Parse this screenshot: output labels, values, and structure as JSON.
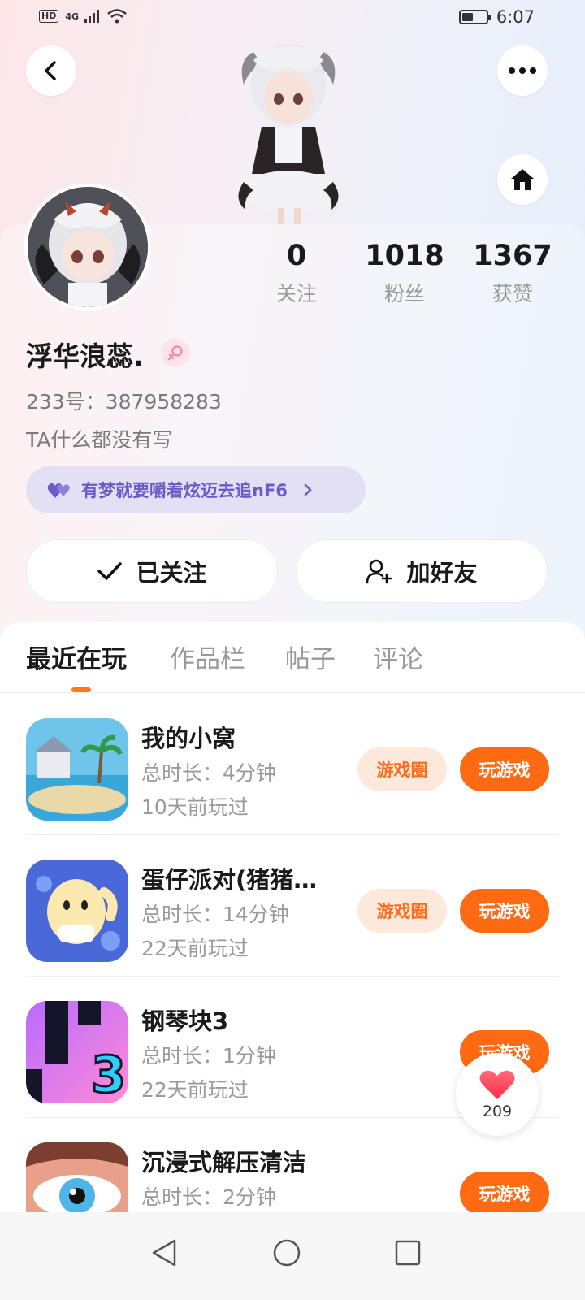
{
  "status_bar": {
    "hd": "HD",
    "network": "4G",
    "time": "6:07",
    "battery_level": 0.45
  },
  "header": {
    "back_icon": "chevron-left-icon",
    "more_icon": "more-dots-icon",
    "home_icon": "home-icon"
  },
  "profile": {
    "stats": [
      {
        "value": "0",
        "label": "关注"
      },
      {
        "value": "1018",
        "label": "粉丝"
      },
      {
        "value": "1367",
        "label": "获赞"
      }
    ],
    "nickname": "浮华浪蕊.",
    "gender": "female",
    "uid": "233号：387958283",
    "bio": "TA什么都没有写",
    "motto": "有梦就要嚼着炫迈去追nF6"
  },
  "actions": {
    "follow_label": "已关注",
    "add_friend_label": "加好友"
  },
  "tabs": [
    {
      "label": "最近在玩",
      "active": true
    },
    {
      "label": "作品栏",
      "active": false
    },
    {
      "label": "帖子",
      "active": false
    },
    {
      "label": "评论",
      "active": false
    }
  ],
  "games": [
    {
      "title": "我的小窝",
      "duration": "总时长：4分钟",
      "last_played": "10天前玩过",
      "circle_label": "游戏圈",
      "play_label": "玩游戏",
      "has_circle": true
    },
    {
      "title": "蛋仔派对(猪猪…",
      "duration": "总时长：14分钟",
      "last_played": "22天前玩过",
      "circle_label": "游戏圈",
      "play_label": "玩游戏",
      "has_circle": true
    },
    {
      "title": "钢琴块3",
      "duration": "总时长：1分钟",
      "last_played": "22天前玩过",
      "play_label": "玩游戏",
      "has_circle": false
    },
    {
      "title": "沉浸式解压清洁",
      "duration": "总时长：2分钟",
      "last_played": "",
      "play_label": "玩游戏",
      "has_circle": false
    }
  ],
  "like_float": {
    "count": "209"
  },
  "colors": {
    "accent": "#ff6a12",
    "motto": "#6b5bc8",
    "gender": "#f08fae"
  }
}
